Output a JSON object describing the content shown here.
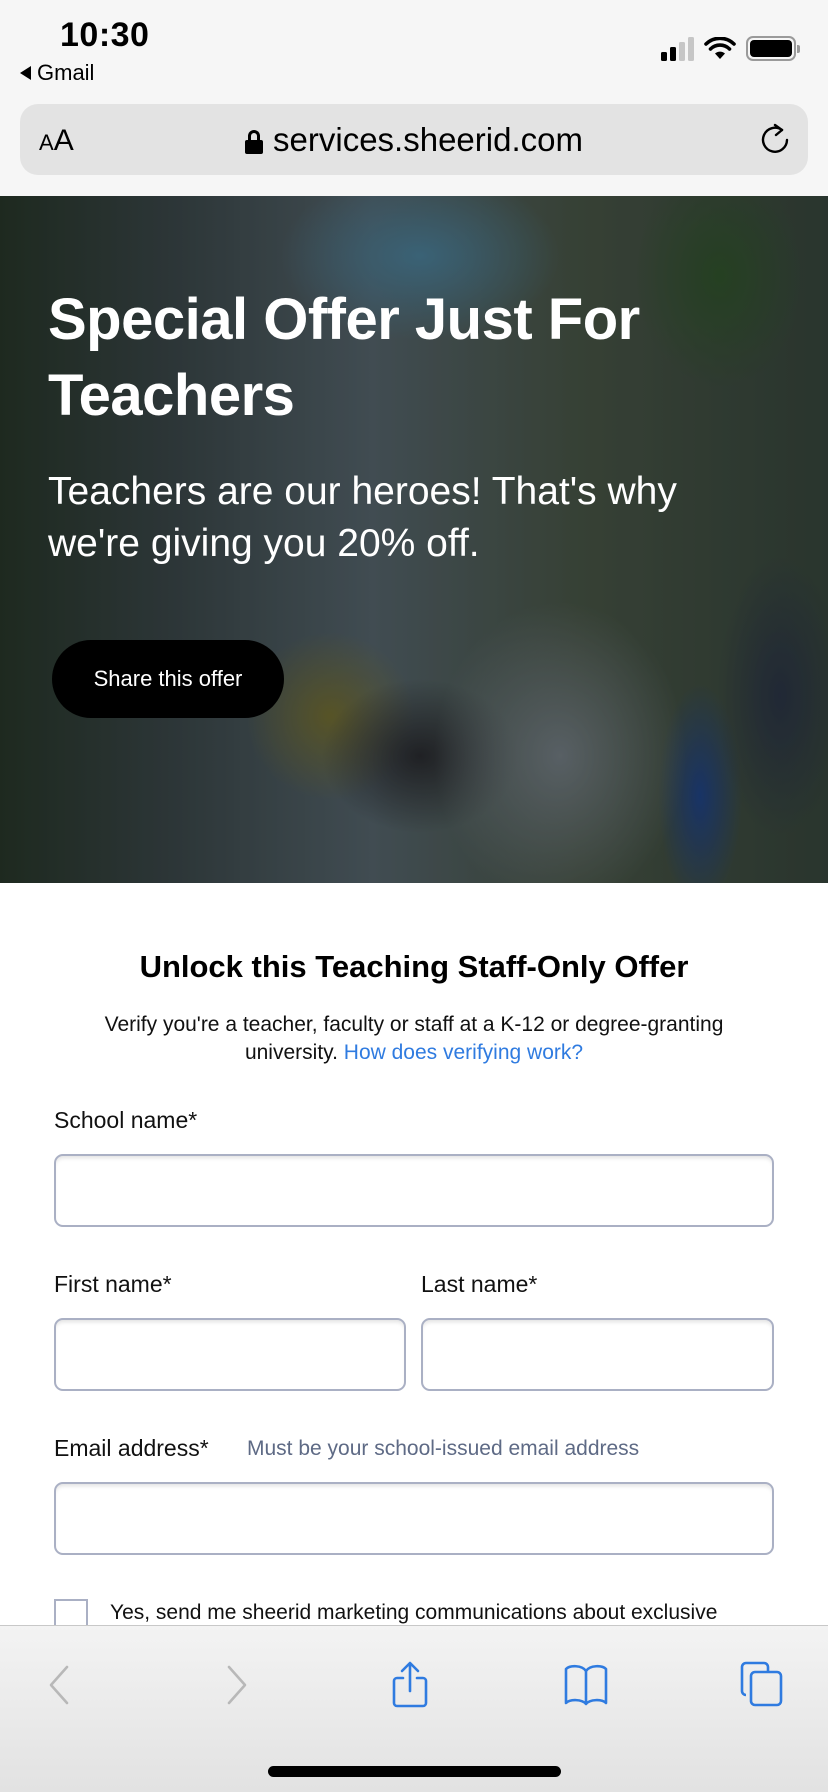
{
  "status_bar": {
    "time": "10:30",
    "back_app": "Gmail",
    "signal_bars_filled": 2,
    "signal_bars_total": 4,
    "battery_level": 1.0,
    "icons": [
      "signal-icon",
      "wifi-icon",
      "battery-icon"
    ]
  },
  "address_bar": {
    "text_size_label_small": "A",
    "text_size_label_large": "A",
    "url": "services.sheerid.com",
    "secure": true,
    "reload_icon": "reload-icon"
  },
  "hero": {
    "title": "Special Offer Just For Teachers",
    "subtitle": "Teachers are our heroes! That's why we're giving you 20% off.",
    "share_button": "Share this offer"
  },
  "form": {
    "title": "Unlock this Teaching Staff-Only Offer",
    "description": "Verify you're a teacher, faculty or staff at a K-12 or degree-granting university.",
    "help_link": "How does verifying work?",
    "link_color": "#2f7be0",
    "fields": {
      "school_name": {
        "label": "School name*",
        "value": ""
      },
      "first_name": {
        "label": "First name*",
        "value": ""
      },
      "last_name": {
        "label": "Last name*",
        "value": ""
      },
      "email": {
        "label": "Email address*",
        "hint": "Must be your school-issued email address",
        "value": ""
      }
    },
    "marketing_opt_in": {
      "label": "Yes, send me sheerid marketing communications about exclusive",
      "checked": false
    }
  },
  "toolbar": {
    "back_enabled": false,
    "forward_enabled": false,
    "accent_color": "#2f7be0",
    "icons": [
      "back-icon",
      "forward-icon",
      "share-icon",
      "bookmarks-icon",
      "tabs-icon"
    ]
  }
}
